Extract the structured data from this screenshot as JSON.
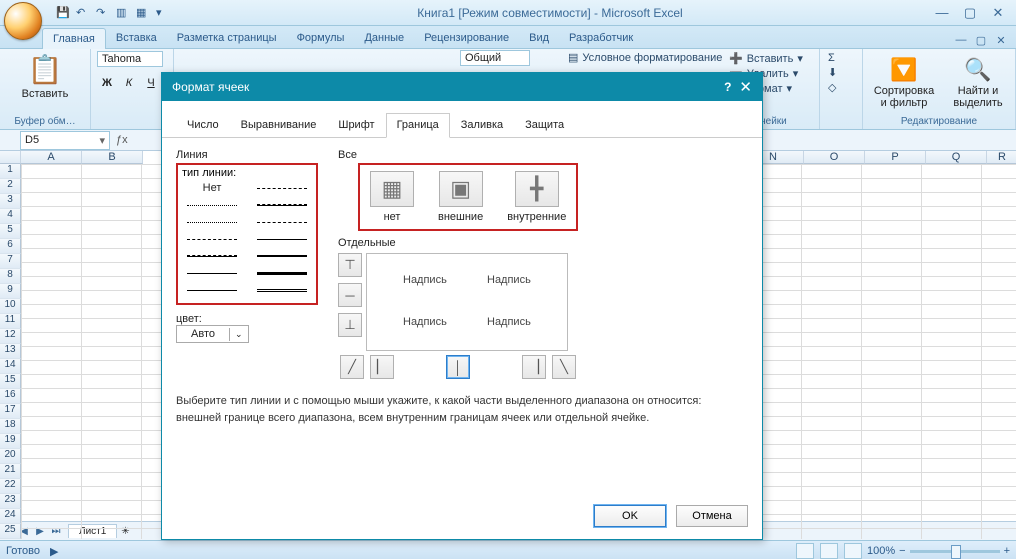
{
  "title": "Книга1  [Режим совместимости] - Microsoft Excel",
  "ribbon_tabs": [
    "Главная",
    "Вставка",
    "Разметка страницы",
    "Формулы",
    "Данные",
    "Рецензирование",
    "Вид",
    "Разработчик"
  ],
  "active_tab_index": 0,
  "clipboard": {
    "paste": "Вставить",
    "group": "Буфер обм…"
  },
  "font": {
    "name": "Tahoma",
    "bold": "Ж",
    "italic": "К",
    "underline": "Ч"
  },
  "number": {
    "format": "Общий"
  },
  "cond_format": "Условное форматирование",
  "cells": {
    "insert": "Вставить",
    "delete": "Удалить",
    "format": "Формат",
    "group": "Ячейки"
  },
  "editing": {
    "sort": "Сортировка и фильтр",
    "find": "Найти и выделить",
    "group": "Редактирование"
  },
  "namebox": "D5",
  "columns_left": [
    "A",
    "B"
  ],
  "columns_right": [
    "N",
    "O",
    "P",
    "Q",
    "R"
  ],
  "rows": [
    "1",
    "2",
    "3",
    "4",
    "5",
    "6",
    "7",
    "8",
    "9",
    "10",
    "11",
    "12",
    "13",
    "14",
    "15",
    "16",
    "17",
    "18",
    "19",
    "20",
    "21",
    "22",
    "23",
    "24",
    "25"
  ],
  "sheet_tab": "Лист1",
  "status": "Готово",
  "zoom": "100%",
  "dialog": {
    "title": "Формат ячеек",
    "tabs": [
      "Число",
      "Выравнивание",
      "Шрифт",
      "Граница",
      "Заливка",
      "Защита"
    ],
    "active_tab_index": 3,
    "line_section": "Линия",
    "line_type": "тип линии:",
    "none": "Нет",
    "color_label": "цвет:",
    "color_value": "Авто",
    "all_section": "Все",
    "presets": {
      "none": "нет",
      "outer": "внешние",
      "inner": "внутренние"
    },
    "separate_section": "Отдельные",
    "preview_label": "Надпись",
    "hint": "Выберите тип линии и с помощью мыши укажите, к какой части выделенного диапазона он относится: внешней границе всего диапазона, всем внутренним границам ячеек или отдельной ячейке.",
    "ok": "OK",
    "cancel": "Отмена"
  }
}
